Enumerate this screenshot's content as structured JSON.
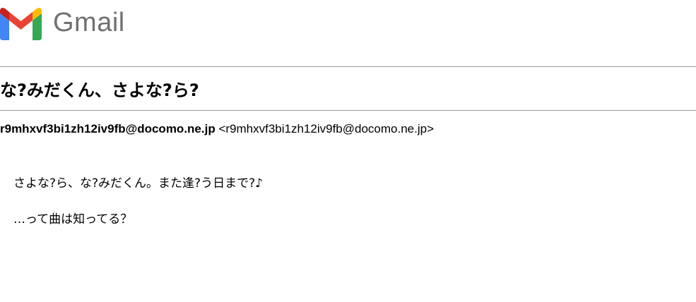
{
  "header": {
    "logo_text": "Gmail",
    "logo_icon": "gmail-m-logo",
    "colors": {
      "red": "#EA4335",
      "blue": "#4285F4",
      "green": "#34A853",
      "yellow": "#FBBC04",
      "dark_red": "#C5221F",
      "wordmark": "#707070"
    }
  },
  "email": {
    "subject": "な?みだくん、さよな?ら?",
    "sender_name": "r9mhxvf3bi1zh12iv9fb@docomo.ne.jp",
    "sender_address": "<r9mhxvf3bi1zh12iv9fb@docomo.ne.jp>",
    "body": [
      "さよな?ら、な?みだくん。また逢?う日まで?♪",
      "…って曲は知ってる？"
    ]
  }
}
